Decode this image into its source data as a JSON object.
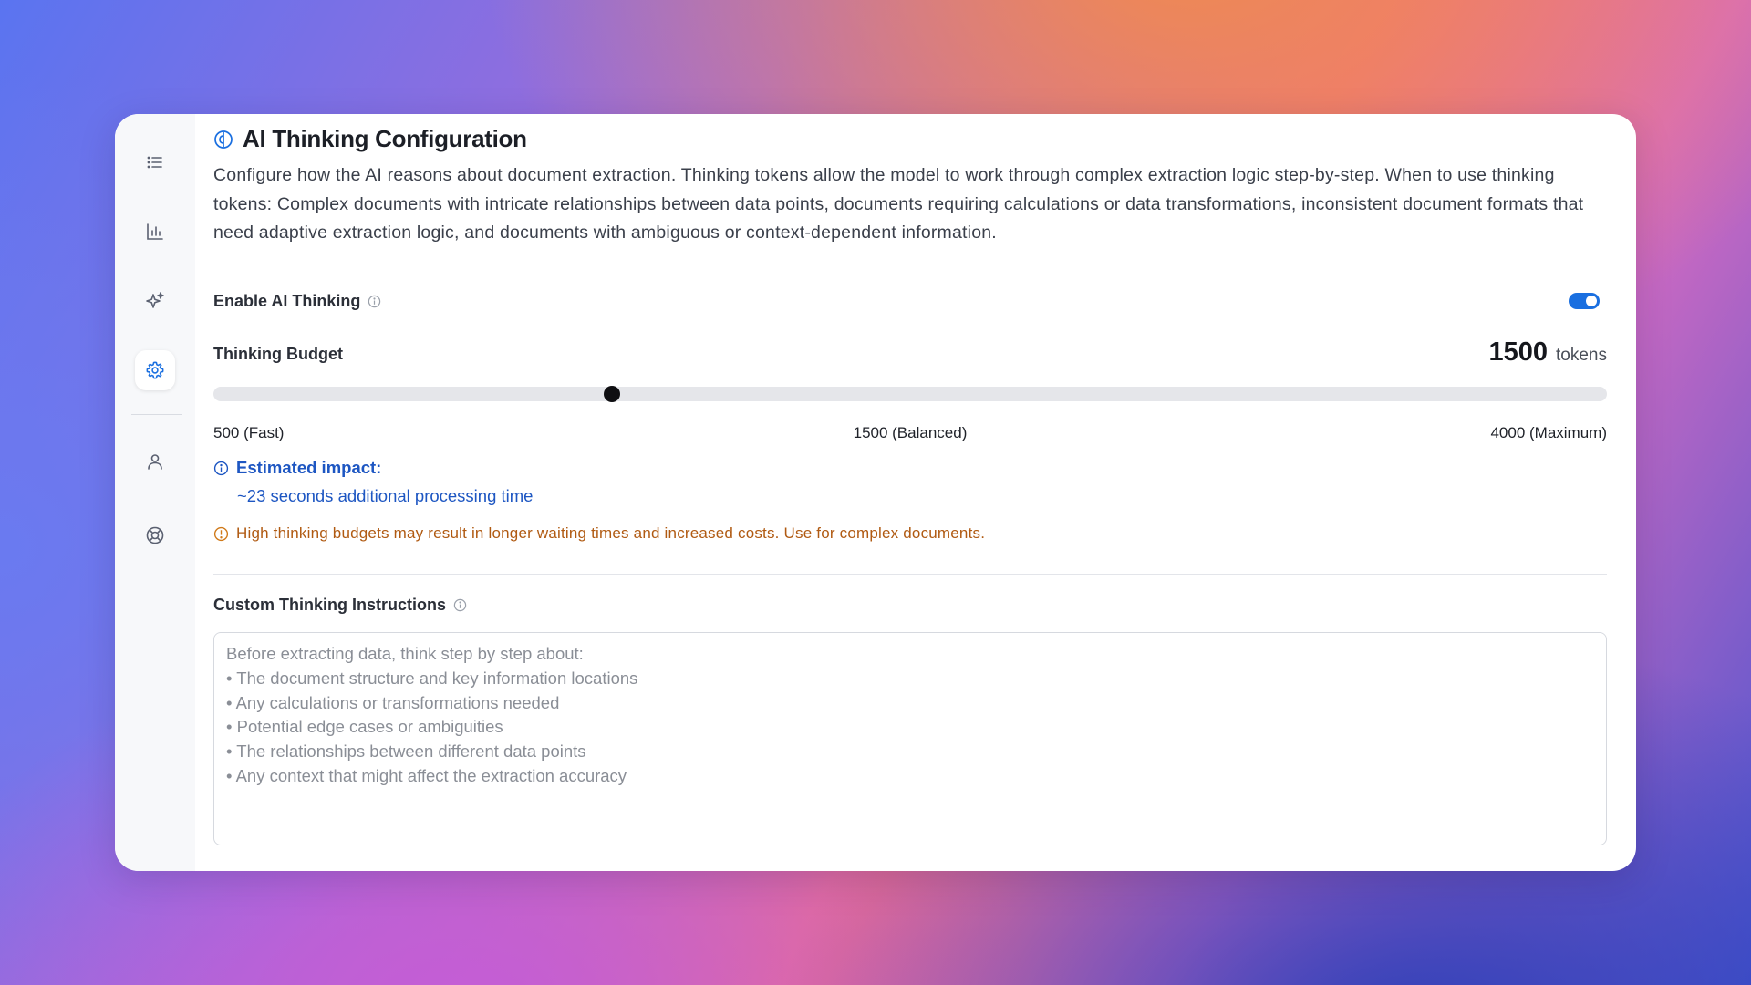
{
  "sidebar": {
    "icons": [
      "list-icon",
      "chart-icon",
      "sparkles-icon",
      "gear-icon",
      "user-icon",
      "lifebuoy-icon"
    ],
    "active": "gear-icon"
  },
  "header": {
    "title": "AI Thinking Configuration",
    "description": "Configure how the AI reasons about document extraction. Thinking tokens allow the model to work through complex extraction logic step-by-step. When to use thinking tokens: Complex documents with intricate relationships between data points, documents requiring calculations or data transformations, inconsistent document formats that need adaptive extraction logic, and documents with ambiguous or context-dependent information."
  },
  "enable_thinking": {
    "label": "Enable AI Thinking",
    "enabled": true
  },
  "budget": {
    "label": "Thinking Budget",
    "value": "1500",
    "unit": "tokens",
    "min_value": 500,
    "max_value": 4000,
    "current": 1500,
    "min_label": "500 (Fast)",
    "mid_label": "1500 (Balanced)",
    "max_label": "4000 (Maximum)"
  },
  "impact": {
    "title": "Estimated impact:",
    "detail": "~23 seconds additional processing time"
  },
  "warning": {
    "text": "High thinking budgets may result in longer waiting times and increased costs. Use for complex documents."
  },
  "custom_instructions": {
    "label": "Custom Thinking Instructions",
    "placeholder": "Before extracting data, think step by step about:\n• The document structure and key information locations\n• Any calculations or transformations needed\n• Potential edge cases or ambiguities\n• The relationships between different data points\n• Any context that might affect the extraction accuracy"
  },
  "colors": {
    "accent": "#1a6fe0",
    "info_text": "#1d56c2",
    "warning_text": "#b05a12",
    "slider_thumb": "#0f0f12"
  }
}
